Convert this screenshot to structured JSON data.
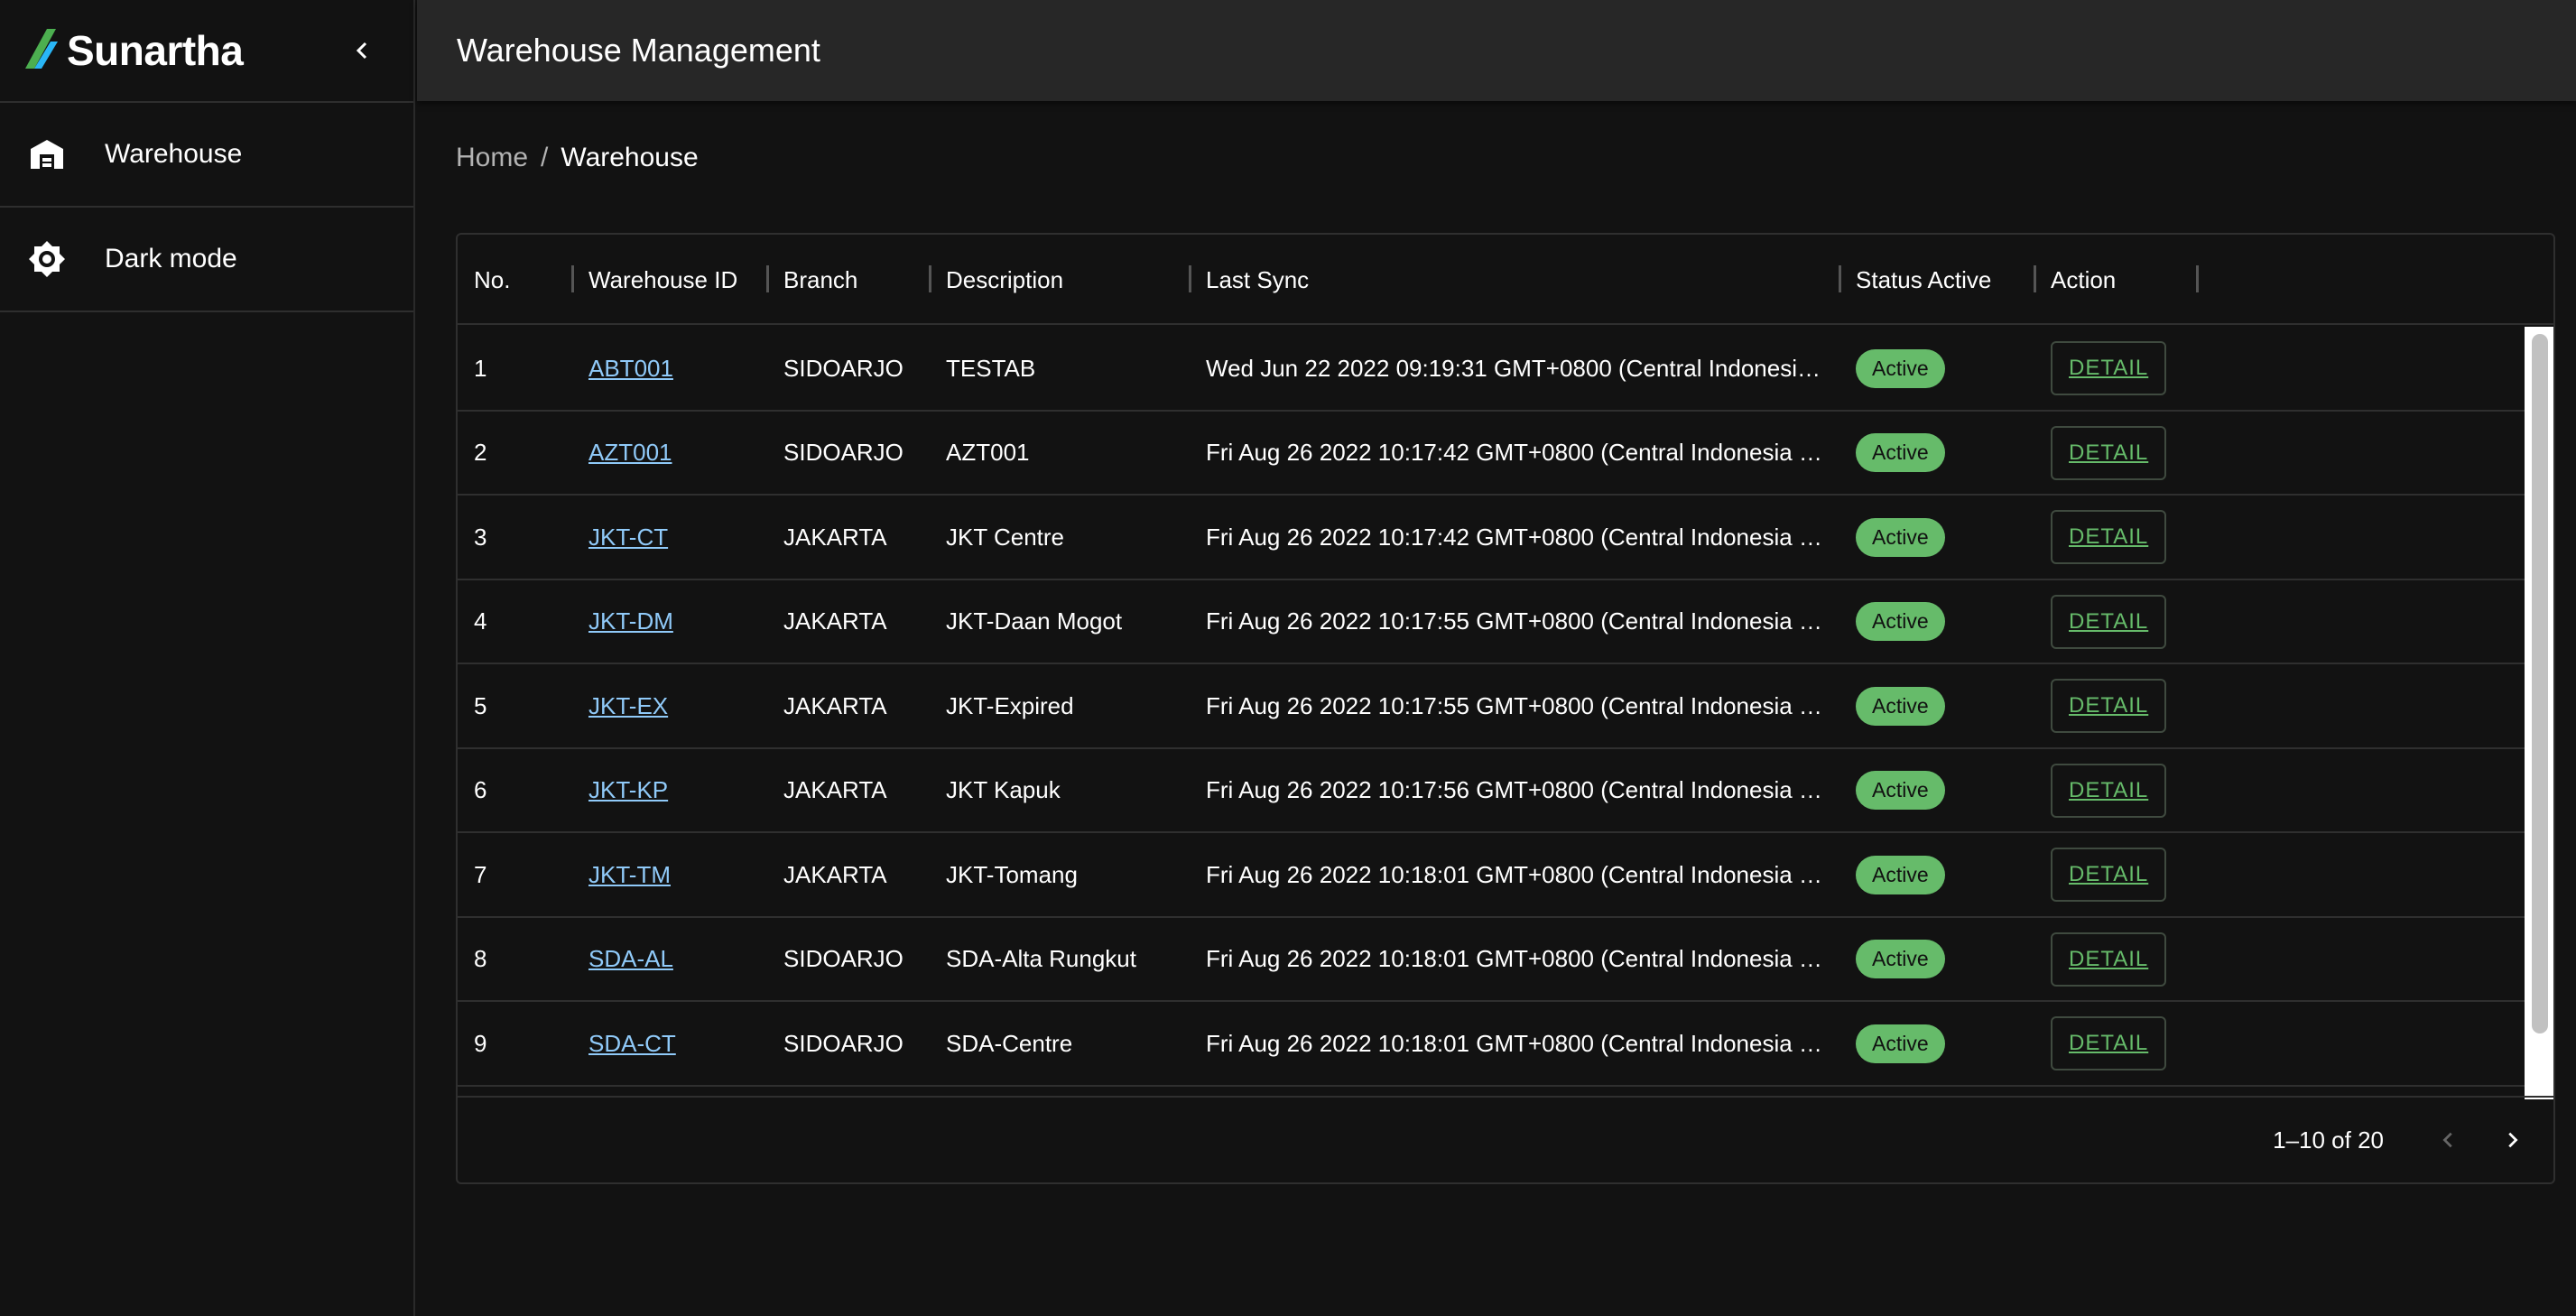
{
  "brand": {
    "name": "Sunartha",
    "logo_icon": "leaf-logo-icon"
  },
  "sidebar": {
    "collapse_icon": "chevron-left-icon",
    "items": [
      {
        "label": "Warehouse",
        "icon": "warehouse-icon"
      },
      {
        "label": "Dark mode",
        "icon": "brightness-icon"
      }
    ]
  },
  "header": {
    "title": "Warehouse Management"
  },
  "breadcrumb": {
    "home": "Home",
    "separator": "/",
    "current": "Warehouse"
  },
  "table": {
    "columns": [
      "No.",
      "Warehouse ID",
      "Branch",
      "Description",
      "Last Sync",
      "Status Active",
      "Action"
    ],
    "rows": [
      {
        "no": "1",
        "id": "ABT001",
        "branch": "SIDOARJO",
        "description": "TESTAB",
        "last_sync": "Wed Jun 22 2022 09:19:31 GMT+0800 (Central Indonesi…",
        "status": "Active",
        "action": "DETAIL"
      },
      {
        "no": "2",
        "id": "AZT001",
        "branch": "SIDOARJO",
        "description": "AZT001",
        "last_sync": "Fri Aug 26 2022 10:17:42 GMT+0800 (Central Indonesia …",
        "status": "Active",
        "action": "DETAIL"
      },
      {
        "no": "3",
        "id": "JKT-CT",
        "branch": "JAKARTA",
        "description": "JKT Centre",
        "last_sync": "Fri Aug 26 2022 10:17:42 GMT+0800 (Central Indonesia …",
        "status": "Active",
        "action": "DETAIL"
      },
      {
        "no": "4",
        "id": "JKT-DM",
        "branch": "JAKARTA",
        "description": "JKT-Daan Mogot",
        "last_sync": "Fri Aug 26 2022 10:17:55 GMT+0800 (Central Indonesia …",
        "status": "Active",
        "action": "DETAIL"
      },
      {
        "no": "5",
        "id": "JKT-EX",
        "branch": "JAKARTA",
        "description": "JKT-Expired",
        "last_sync": "Fri Aug 26 2022 10:17:55 GMT+0800 (Central Indonesia …",
        "status": "Active",
        "action": "DETAIL"
      },
      {
        "no": "6",
        "id": "JKT-KP",
        "branch": "JAKARTA",
        "description": "JKT Kapuk",
        "last_sync": "Fri Aug 26 2022 10:17:56 GMT+0800 (Central Indonesia …",
        "status": "Active",
        "action": "DETAIL"
      },
      {
        "no": "7",
        "id": "JKT-TM",
        "branch": "JAKARTA",
        "description": "JKT-Tomang",
        "last_sync": "Fri Aug 26 2022 10:18:01 GMT+0800 (Central Indonesia …",
        "status": "Active",
        "action": "DETAIL"
      },
      {
        "no": "8",
        "id": "SDA-AL",
        "branch": "SIDOARJO",
        "description": "SDA-Alta Rungkut",
        "last_sync": "Fri Aug 26 2022 10:18:01 GMT+0800 (Central Indonesia …",
        "status": "Active",
        "action": "DETAIL"
      },
      {
        "no": "9",
        "id": "SDA-CT",
        "branch": "SIDOARJO",
        "description": "SDA-Centre",
        "last_sync": "Fri Aug 26 2022 10:18:01 GMT+0800 (Central Indonesia …",
        "status": "Active",
        "action": "DETAIL"
      }
    ]
  },
  "pagination": {
    "label": "1–10 of 20",
    "prev_icon": "chevron-left-icon",
    "next_icon": "chevron-right-icon"
  },
  "colors": {
    "background": "#121212",
    "topbar": "#272727",
    "link": "#90caf9",
    "status_active": "#66bb6a"
  }
}
